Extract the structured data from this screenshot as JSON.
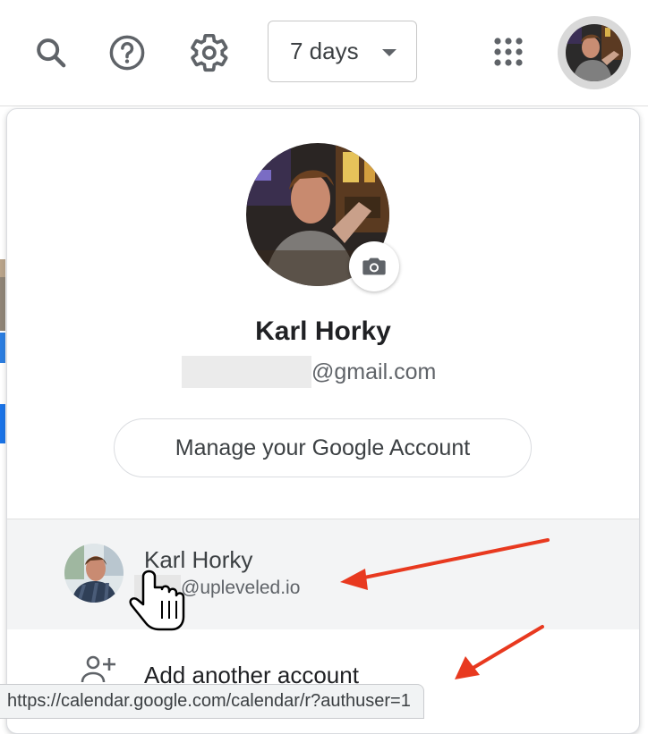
{
  "toolbar": {
    "range_select_value": "7 days",
    "icons": [
      "search-icon",
      "help-icon",
      "settings-icon",
      "apps-grid-icon",
      "chevron-down-icon"
    ]
  },
  "account_panel": {
    "name": "Karl Horky",
    "email_suffix": "@gmail.com",
    "manage_label": "Manage your Google Account",
    "accounts": [
      {
        "name": "Karl Horky",
        "email_suffix": "@upleveled.io"
      }
    ],
    "add_account_label": "Add another account"
  },
  "status_bar": {
    "url": "https://calendar.google.com/calendar/r?authuser=1"
  },
  "colors": {
    "annotation_arrow": "#e8391f",
    "hover_row": "#f3f4f5",
    "icon_gray": "#5f6368",
    "text_dark": "#202124"
  }
}
